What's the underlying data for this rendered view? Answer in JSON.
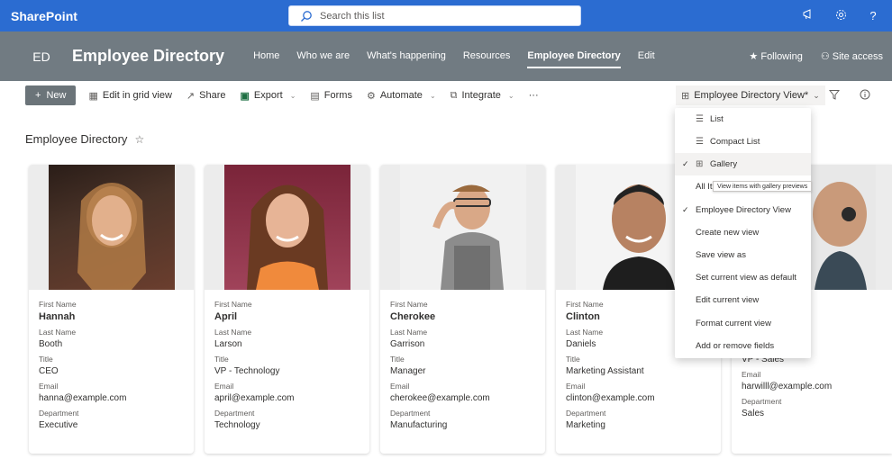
{
  "suite": {
    "brand": "SharePoint",
    "search_placeholder": "Search this list",
    "icons": [
      "megaphone-icon",
      "gear-icon",
      "help-icon"
    ]
  },
  "site": {
    "logo": "ED",
    "title": "Employee Directory",
    "nav": [
      "Home",
      "Who we are",
      "What's happening",
      "Resources",
      "Employee Directory",
      "Edit"
    ],
    "following": "Following",
    "site_access": "Site access"
  },
  "commands": {
    "new": "New",
    "edit_grid": "Edit in grid view",
    "share": "Share",
    "export": "Export",
    "forms": "Forms",
    "automate": "Automate",
    "integrate": "Integrate",
    "more": "···",
    "view": "Employee Directory View*"
  },
  "page": {
    "title": "Employee Directory"
  },
  "labels": {
    "first": "First Name",
    "last": "Last Name",
    "title": "Title",
    "email": "Email",
    "dept": "Department"
  },
  "employees": [
    {
      "first": "Hannah",
      "last": "Booth",
      "title": "CEO",
      "email": "hanna@example.com",
      "dept": "Executive",
      "bg": "#3d2b25"
    },
    {
      "first": "April",
      "last": "Larson",
      "title": "VP - Technology",
      "email": "april@example.com",
      "dept": "Technology",
      "bg": "#8a2f45"
    },
    {
      "first": "Cherokee",
      "last": "Garrison",
      "title": "Manager",
      "email": "cherokee@example.com",
      "dept": "Manufacturing",
      "bg": "#efefef"
    },
    {
      "first": "Clinton",
      "last": "Daniels",
      "title": "Marketing Assistant",
      "email": "clinton@example.com",
      "dept": "Marketing",
      "bg": "#f2f2f2"
    },
    {
      "first": "",
      "last": "",
      "title": "VP - Sales",
      "email": "harwilll@example.com",
      "dept": "Sales",
      "bg": "#ececec"
    }
  ],
  "menu": {
    "items": [
      "List",
      "Compact List",
      "Gallery",
      "All It",
      "Employee Directory View",
      "Create new view",
      "Save view as",
      "Set current view as default",
      "Edit current view",
      "Format current view",
      "Add or remove fields"
    ],
    "tooltip": "View items with gallery previews"
  }
}
